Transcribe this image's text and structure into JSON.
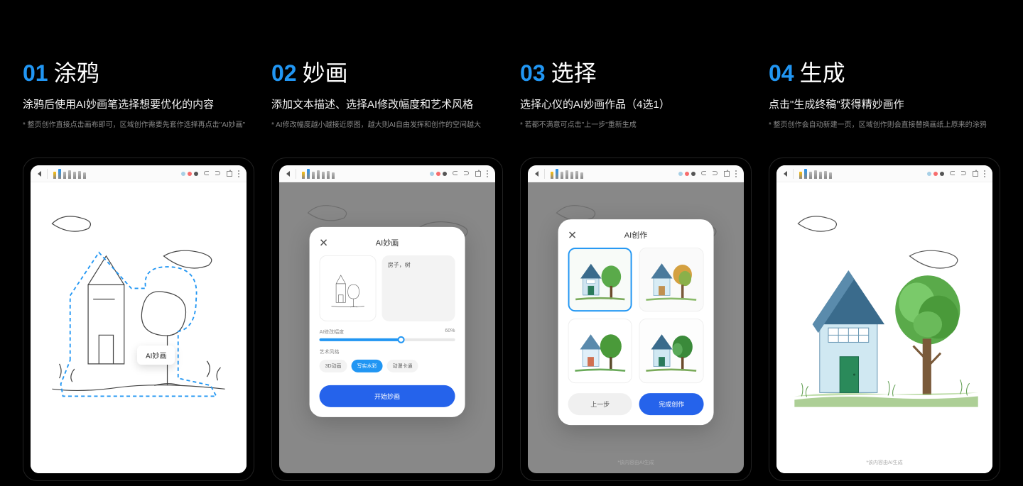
{
  "steps": [
    {
      "num": "01",
      "title": "涂鸦",
      "desc": "涂鸦后使用AI妙画笔选择想要优化的内容",
      "note": "* 整页创作直接点击画布即可，区域创作需要先套作选择再点击\"AI妙画\""
    },
    {
      "num": "02",
      "title": "妙画",
      "desc": "添加文本描述、选择AI修改幅度和艺术风格",
      "note": "* AI修改幅度越小越接近原图，越大则AI自由发挥和创作的空间越大"
    },
    {
      "num": "03",
      "title": "选择",
      "desc": "选择心仪的AI妙画作品（4选1）",
      "note": "* 若都不满意可点击\"上一步\"重新生成"
    },
    {
      "num": "04",
      "title": "生成",
      "desc": "点击\"生成终稿\"获得精妙画作",
      "note": "* 整页创作会自动新建一页，区域创作则会直接替换画纸上原来的涂鸦"
    }
  ],
  "tooltip": "AI妙画",
  "modal1": {
    "title": "AI妙画",
    "prompt": "房子，树",
    "slider_label": "AI修改幅度",
    "slider_value": "60%",
    "style_label": "艺术风格",
    "chips": [
      "3D动画",
      "写实水彩",
      "动漫卡通"
    ],
    "button": "开始妙画"
  },
  "modal2": {
    "title": "AI创作",
    "back": "上一步",
    "done": "完成创作",
    "disclaimer": "*该内容由AI生成"
  },
  "screen4_disclaimer": "*该内容由AI生成"
}
